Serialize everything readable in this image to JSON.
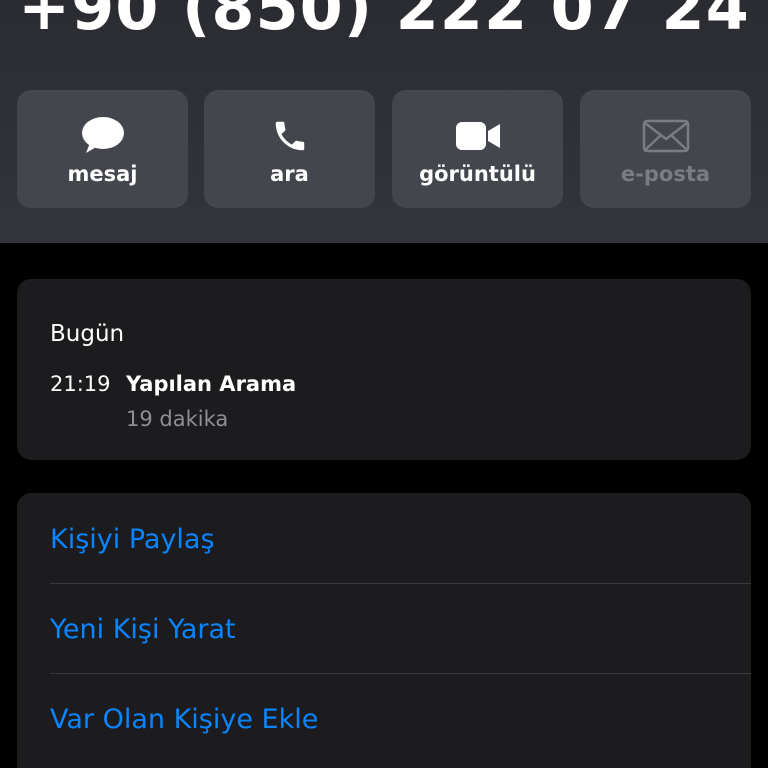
{
  "contact": {
    "phone": "+90 (850) 222 07 24"
  },
  "actions": [
    {
      "label": "mesaj",
      "icon": "message-bubble-icon",
      "enabled": true
    },
    {
      "label": "ara",
      "icon": "phone-icon",
      "enabled": true
    },
    {
      "label": "görüntülü",
      "icon": "video-camera-icon",
      "enabled": true
    },
    {
      "label": "e-posta",
      "icon": "envelope-icon",
      "enabled": false
    }
  ],
  "history": {
    "day": "Bugün",
    "entries": [
      {
        "time": "21:19",
        "type": "Yapılan Arama",
        "duration": "19 dakika"
      }
    ]
  },
  "options": [
    {
      "label": "Kişiyi Paylaş"
    },
    {
      "label": "Yeni Kişi Yarat"
    },
    {
      "label": "Var Olan Kişiye Ekle"
    }
  ],
  "colors": {
    "accent": "#0a84ff",
    "card": "#1c1c1e",
    "header": "#2f3137",
    "disabled": "#7a7c84"
  }
}
